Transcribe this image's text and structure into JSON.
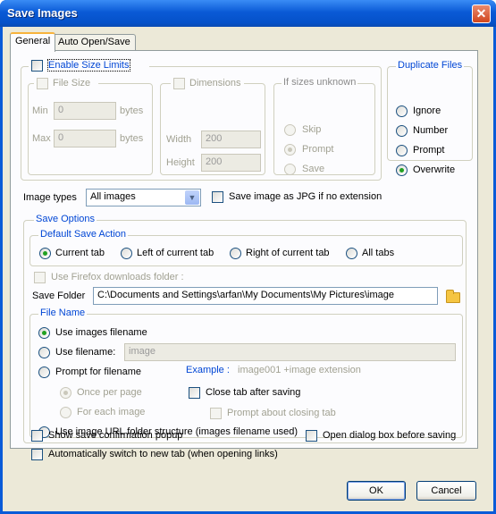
{
  "window": {
    "title": "Save Images",
    "close_label": "✕"
  },
  "tabs": [
    {
      "label": "General",
      "active": true
    },
    {
      "label": "Auto Open/Save",
      "active": false
    }
  ],
  "size_limits": {
    "enable_label": "Enable Size Limits",
    "enabled": false,
    "file_size": {
      "label": "File Size",
      "min_label": "Min",
      "min_value": "0",
      "max_label": "Max",
      "max_value": "0",
      "unit": "bytes"
    },
    "dimensions": {
      "label": "Dimensions",
      "width_label": "Width",
      "width_value": "200",
      "height_label": "Height",
      "height_value": "200"
    },
    "if_unknown": {
      "legend": "If sizes unknown",
      "options": [
        "Skip",
        "Prompt",
        "Save"
      ],
      "selected": "Prompt"
    }
  },
  "duplicate_files": {
    "legend": "Duplicate Files",
    "options": [
      "Ignore",
      "Number",
      "Prompt",
      "Overwrite"
    ],
    "selected": "Overwrite"
  },
  "image_types": {
    "label": "Image types",
    "value": "All images",
    "jpg_label": "Save image as JPG if no extension",
    "jpg_checked": false
  },
  "save_options": {
    "legend": "Save Options",
    "default_action": {
      "legend": "Default Save Action",
      "options": [
        "Current tab",
        "Left of current tab",
        "Right of current tab",
        "All tabs"
      ],
      "selected": "Current tab"
    },
    "firefox_downloads_label": "Use Firefox downloads folder :",
    "save_folder_label": "Save Folder",
    "save_folder_value": "C:\\Documents and Settings\\arfan\\My Documents\\My Pictures\\image",
    "file_name": {
      "legend": "File Name",
      "use_images_filename": "Use images filename",
      "use_filename": "Use filename:",
      "filename_placeholder": "image",
      "prompt_for_filename": "Prompt for filename",
      "example_label": "Example :",
      "example_value": "image001 +image extension",
      "once_per_page": "Once per page",
      "for_each_image": "For each image",
      "close_tab_after_saving": "Close tab after saving",
      "prompt_closing_tab": "Prompt about closing tab",
      "use_url_folder": "Use image URL folder structure (images filename used)",
      "selected": "Use images filename"
    }
  },
  "bottom_options": {
    "show_confirmation": "Show save confirmation popup",
    "open_dialog": "Open dialog box before saving",
    "auto_switch": "Automatically switch to new tab (when opening links)"
  },
  "buttons": {
    "ok": "OK",
    "cancel": "Cancel"
  }
}
